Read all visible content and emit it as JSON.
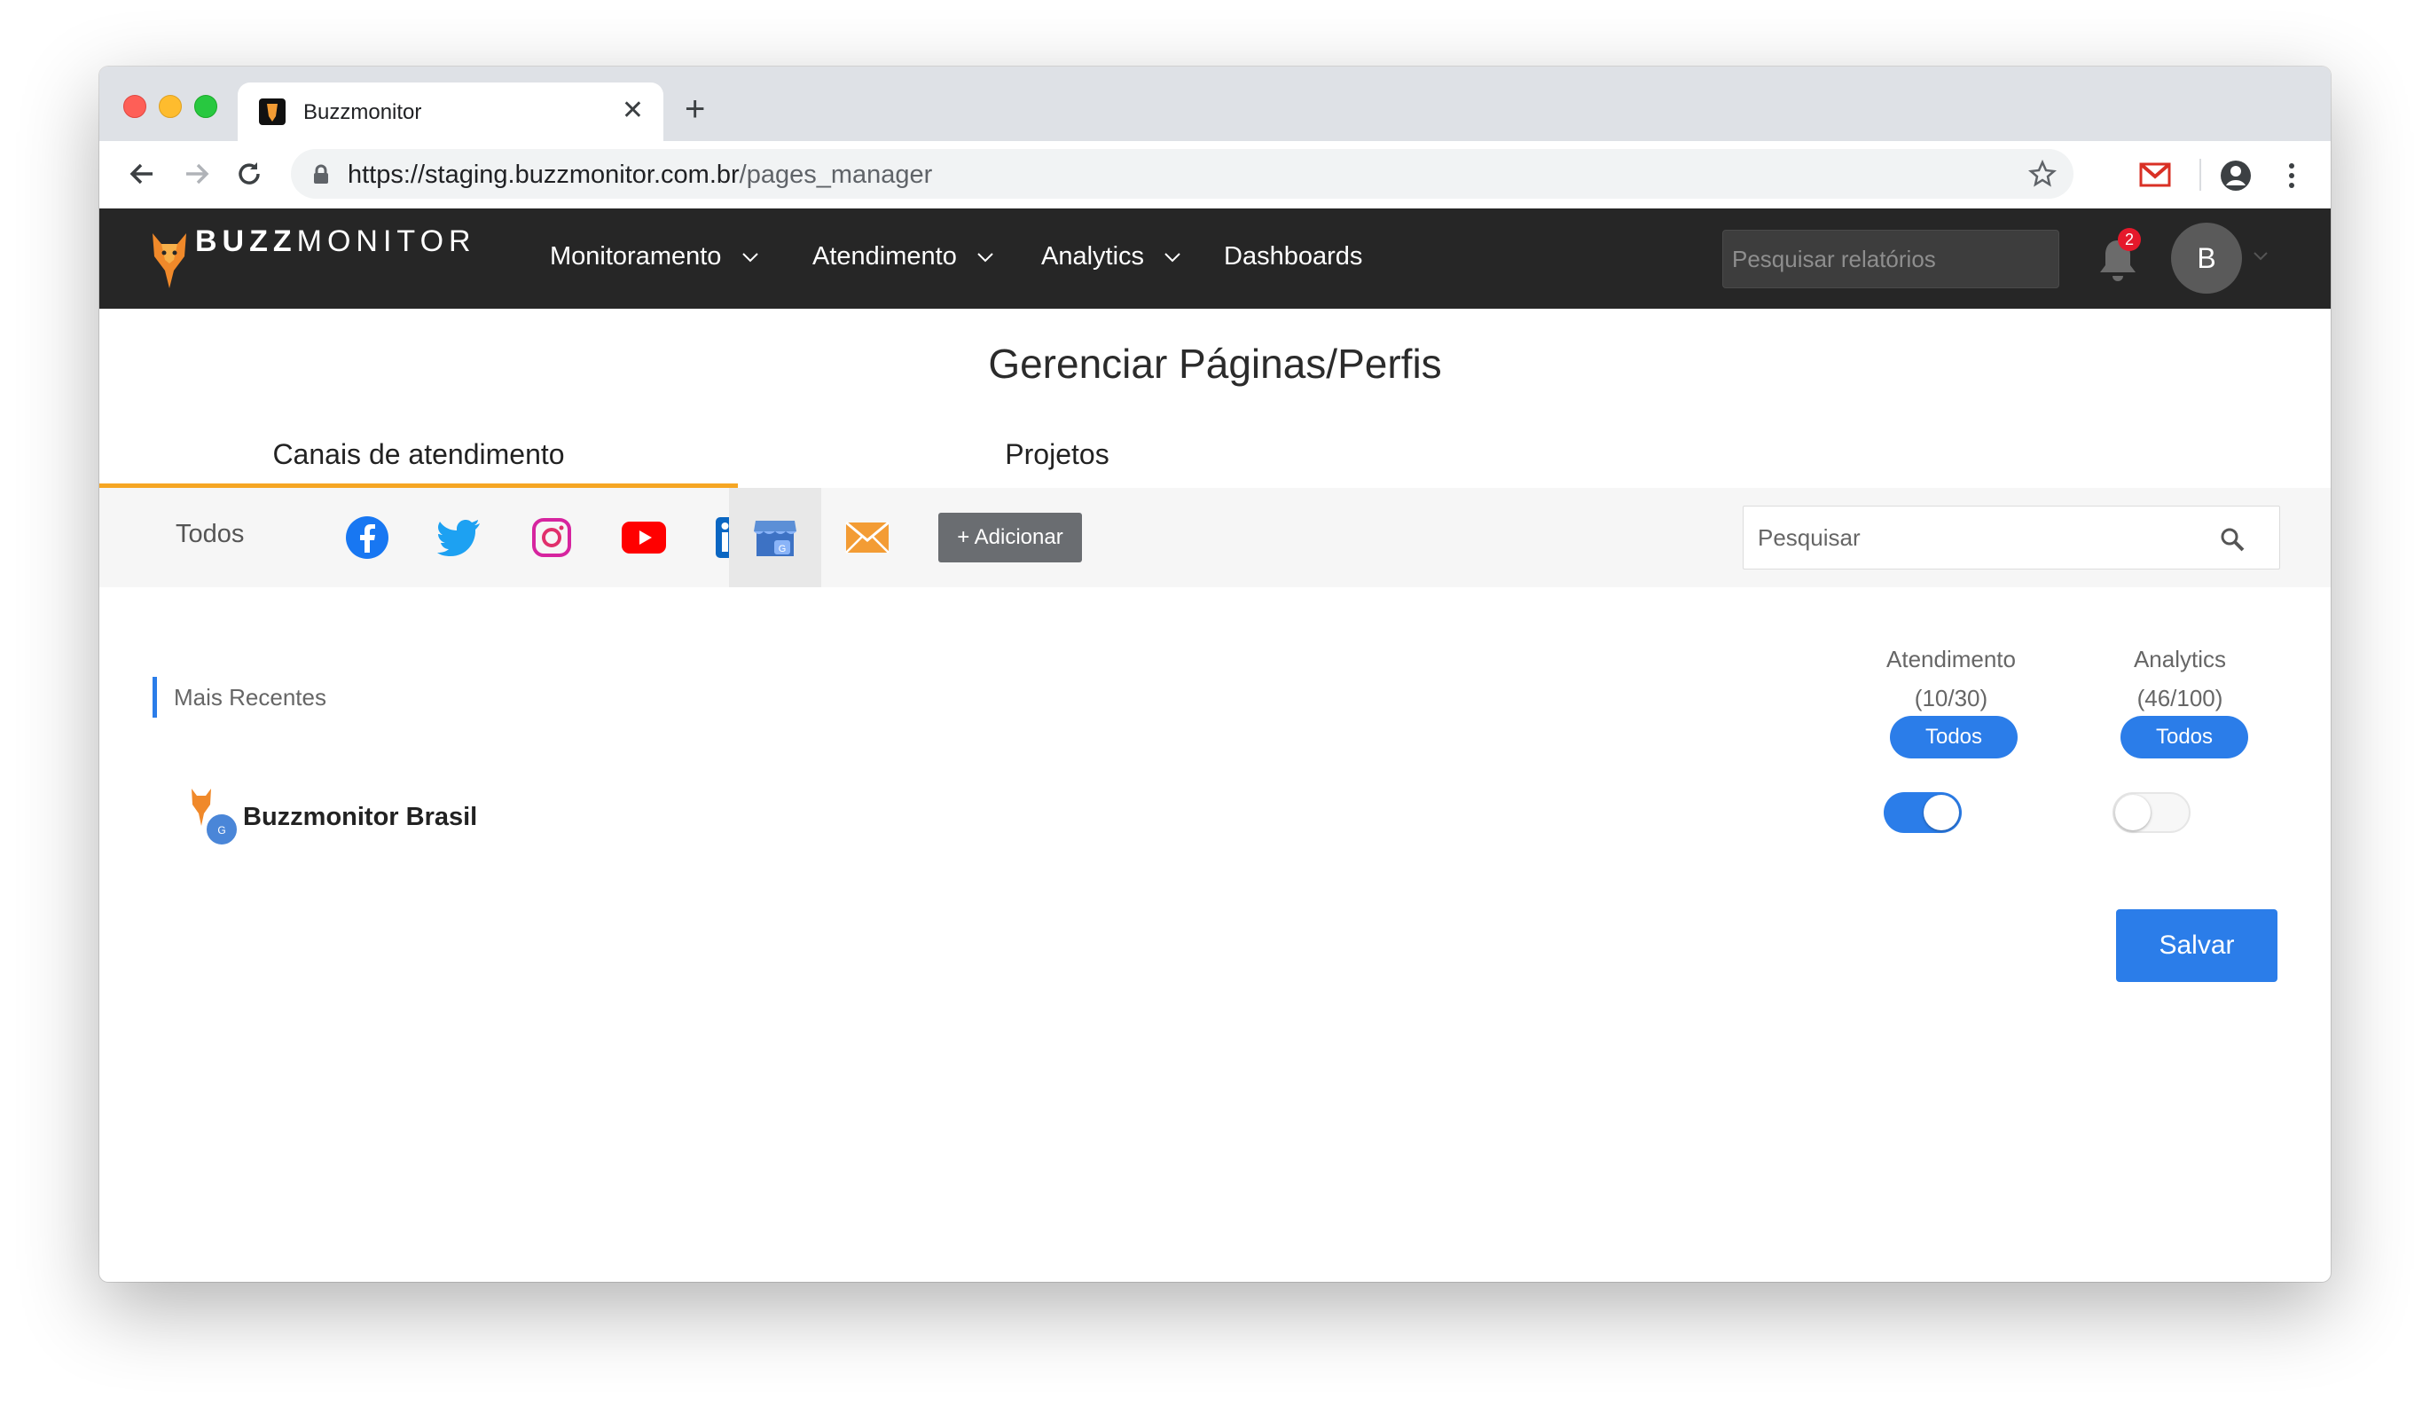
{
  "browser": {
    "tab_title": "Buzzmonitor",
    "url_host": "https://staging.buzzmonitor.com.br",
    "url_path": "/pages_manager"
  },
  "navbar": {
    "brand_bold": "BUZZ",
    "brand_light": "MONITOR",
    "items": [
      {
        "label": "Monitoramento",
        "has_dropdown": true
      },
      {
        "label": "Atendimento",
        "has_dropdown": true
      },
      {
        "label": "Analytics",
        "has_dropdown": true
      },
      {
        "label": "Dashboards",
        "has_dropdown": false
      }
    ],
    "search_placeholder": "Pesquisar relatórios",
    "notification_count": "2",
    "avatar_initial": "B"
  },
  "page": {
    "title": "Gerenciar Páginas/Perfis",
    "tabs": [
      {
        "label": "Canais de atendimento",
        "active": true
      },
      {
        "label": "Projetos",
        "active": false
      }
    ]
  },
  "filters": {
    "all_label": "Todos",
    "channels": [
      "facebook-icon",
      "twitter-icon",
      "instagram-icon",
      "youtube-icon",
      "linkedin-icon",
      "google-my-business-icon",
      "email-icon"
    ],
    "selected_channel": "google-my-business-icon",
    "add_label": "+ Adicionar",
    "search_placeholder": "Pesquisar"
  },
  "list": {
    "section_label": "Mais Recentes",
    "columns": [
      {
        "title": "Atendimento",
        "count": "(10/30)",
        "button": "Todos"
      },
      {
        "title": "Analytics",
        "count": "(46/100)",
        "button": "Todos"
      }
    ],
    "rows": [
      {
        "name": "Buzzmonitor Brasil",
        "atendimento": true,
        "analytics": false
      }
    ]
  },
  "actions": {
    "save_label": "Salvar"
  },
  "colors": {
    "accent_blue": "#2b7de9",
    "tab_underline": "#f6a623",
    "navbar_bg": "#262626"
  }
}
